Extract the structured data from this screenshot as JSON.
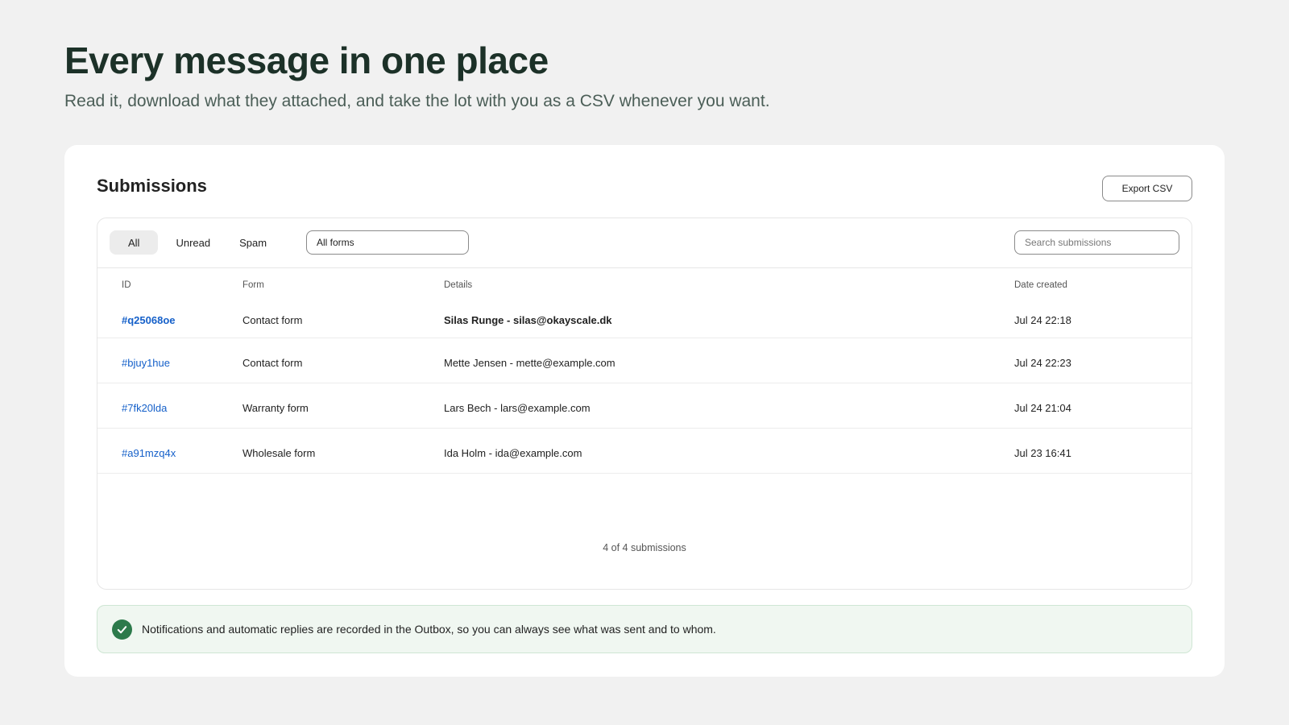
{
  "hero": {
    "title": "Every message in one place",
    "subtitle": "Read it, download what they attached, and take the lot with you as a CSV whenever you want."
  },
  "card": {
    "title": "Submissions",
    "export_label": "Export CSV"
  },
  "filters": {
    "tabs": [
      "All",
      "Unread",
      "Spam"
    ],
    "active_tab": "All",
    "form_select_value": "All forms",
    "search_placeholder": "Search submissions"
  },
  "table": {
    "columns": [
      "ID",
      "Form",
      "Details",
      "Date created"
    ],
    "rows": [
      {
        "id": "#q25068oe",
        "form": "Contact form",
        "details": "Silas Runge - silas@okayscale.dk",
        "date": "Jul 24 22:18",
        "unread": true
      },
      {
        "id": "#bjuy1hue",
        "form": "Contact form",
        "details": "Mette Jensen - mette@example.com",
        "date": "Jul 24 22:23",
        "unread": false
      },
      {
        "id": "#7fk20lda",
        "form": "Warranty form",
        "details": "Lars Bech - lars@example.com",
        "date": "Jul 24 21:04",
        "unread": false
      },
      {
        "id": "#a91mzq4x",
        "form": "Wholesale form",
        "details": "Ida Holm - ida@example.com",
        "date": "Jul 23 16:41",
        "unread": false
      }
    ],
    "count_text": "4 of 4 submissions"
  },
  "notice": {
    "icon": "check-circle-icon",
    "text": "Notifications and automatic replies are recorded in the Outbox, so you can always see what was sent and to whom."
  },
  "colors": {
    "accent_link": "#1560c9",
    "success": "#2c7a4b",
    "heading": "#1c3128"
  }
}
